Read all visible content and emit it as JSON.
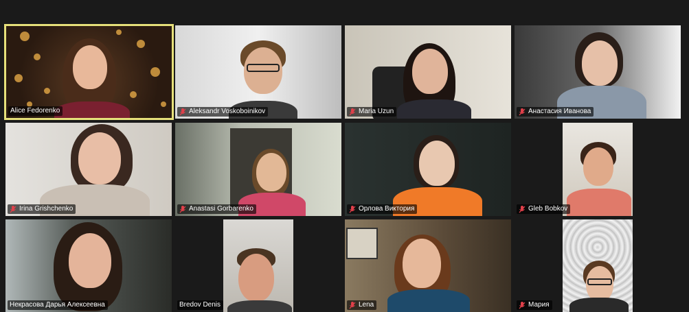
{
  "meeting": {
    "participants": [
      {
        "name": "Alice Fedorenko",
        "muted": false,
        "active": true
      },
      {
        "name": "Aleksandr Voskoboinikov",
        "muted": true,
        "active": false
      },
      {
        "name": "Maria Uzun",
        "muted": true,
        "active": false
      },
      {
        "name": "Анастасия Иванова",
        "muted": true,
        "active": false
      },
      {
        "name": "Irina Grishchenko",
        "muted": true,
        "active": false
      },
      {
        "name": "Anastasi Gorbarenko",
        "muted": true,
        "active": false
      },
      {
        "name": "Орлова Виктория",
        "muted": true,
        "active": false
      },
      {
        "name": "Gleb Bobkov",
        "muted": true,
        "active": false
      },
      {
        "name": "Некрасова Дарья Алексеевна",
        "muted": false,
        "active": false
      },
      {
        "name": "Bredov Denis",
        "muted": false,
        "active": false
      },
      {
        "name": "Lena",
        "muted": true,
        "active": false
      },
      {
        "name": "Мария",
        "muted": true,
        "active": false
      }
    ]
  },
  "colors": {
    "background": "#1a1a1a",
    "active_speaker_border": "#e6e07a",
    "muted_icon": "#e0404a"
  },
  "icons": {
    "muted": "microphone-muted-icon"
  }
}
